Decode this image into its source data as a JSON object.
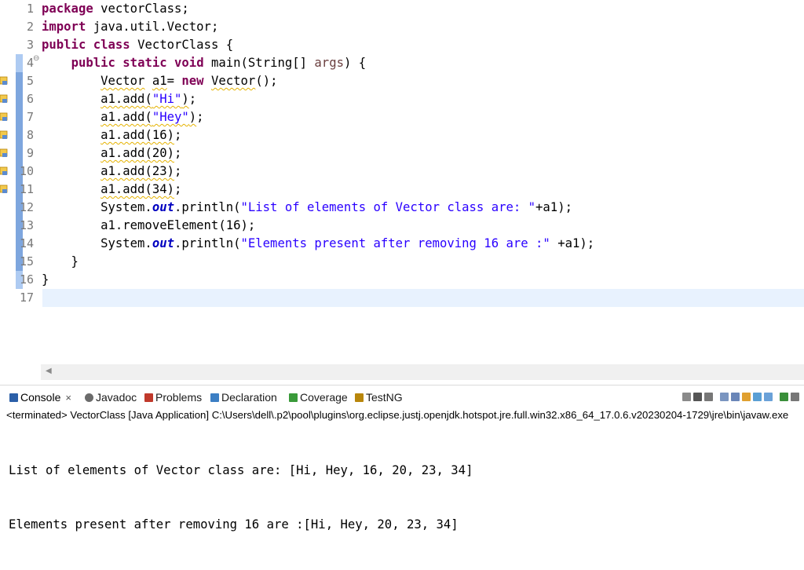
{
  "editor": {
    "lines": [
      {
        "num": "1",
        "segs": [
          {
            "t": "package",
            "c": "kw"
          },
          {
            "t": " vectorClass;"
          }
        ]
      },
      {
        "num": "2",
        "segs": [
          {
            "t": "import",
            "c": "kw"
          },
          {
            "t": " java.util.Vector;"
          }
        ]
      },
      {
        "num": "3",
        "segs": [
          {
            "t": "public",
            "c": "kw"
          },
          {
            "t": " "
          },
          {
            "t": "class",
            "c": "kw"
          },
          {
            "t": " VectorClass {"
          }
        ]
      },
      {
        "num": "4",
        "fold": "⊖",
        "segs": [
          {
            "t": "    "
          },
          {
            "t": "public",
            "c": "kw"
          },
          {
            "t": " "
          },
          {
            "t": "static",
            "c": "kw"
          },
          {
            "t": " "
          },
          {
            "t": "void",
            "c": "kw"
          },
          {
            "t": " main(String[] "
          },
          {
            "t": "args",
            "c": "arg"
          },
          {
            "t": ") {"
          }
        ]
      },
      {
        "num": "5",
        "marker": true,
        "segs": [
          {
            "t": "        "
          },
          {
            "t": "Vector",
            "c": "warn"
          },
          {
            "t": " "
          },
          {
            "t": "a1",
            "c": "warn"
          },
          {
            "t": "= "
          },
          {
            "t": "new",
            "c": "kw"
          },
          {
            "t": " "
          },
          {
            "t": "Vector",
            "c": "warn"
          },
          {
            "t": "();"
          }
        ]
      },
      {
        "num": "6",
        "marker": true,
        "segs": [
          {
            "t": "        "
          },
          {
            "t": "a1.add(",
            "c": "warn"
          },
          {
            "t": "\"Hi\"",
            "c": "str warn"
          },
          {
            "t": ")",
            "c": "warn"
          },
          {
            "t": ";"
          }
        ]
      },
      {
        "num": "7",
        "marker": true,
        "segs": [
          {
            "t": "        "
          },
          {
            "t": "a1.add(",
            "c": "warn"
          },
          {
            "t": "\"Hey\"",
            "c": "str warn"
          },
          {
            "t": ")",
            "c": "warn"
          },
          {
            "t": ";"
          }
        ]
      },
      {
        "num": "8",
        "marker": true,
        "segs": [
          {
            "t": "        "
          },
          {
            "t": "a1.add(16)",
            "c": "warn"
          },
          {
            "t": ";"
          }
        ]
      },
      {
        "num": "9",
        "marker": true,
        "segs": [
          {
            "t": "        "
          },
          {
            "t": "a1.add(20)",
            "c": "warn"
          },
          {
            "t": ";"
          }
        ]
      },
      {
        "num": "10",
        "marker": true,
        "segs": [
          {
            "t": "        "
          },
          {
            "t": "a1.add(23)",
            "c": "warn"
          },
          {
            "t": ";"
          }
        ]
      },
      {
        "num": "11",
        "marker": true,
        "segs": [
          {
            "t": "        "
          },
          {
            "t": "a1.add(34)",
            "c": "warn"
          },
          {
            "t": ";"
          }
        ]
      },
      {
        "num": "12",
        "segs": [
          {
            "t": "        System."
          },
          {
            "t": "out",
            "c": "fld"
          },
          {
            "t": ".println("
          },
          {
            "t": "\"List of elements of Vector class are: \"",
            "c": "str"
          },
          {
            "t": "+a1);"
          }
        ]
      },
      {
        "num": "13",
        "segs": [
          {
            "t": "        a1.removeElement(16);"
          }
        ]
      },
      {
        "num": "14",
        "segs": [
          {
            "t": "        System."
          },
          {
            "t": "out",
            "c": "fld"
          },
          {
            "t": ".println("
          },
          {
            "t": "\"Elements present after removing 16 are :\"",
            "c": "str"
          },
          {
            "t": " +a1);"
          }
        ]
      },
      {
        "num": "15",
        "segs": [
          {
            "t": "    }"
          }
        ]
      },
      {
        "num": "16",
        "segs": [
          {
            "t": "}"
          }
        ]
      },
      {
        "num": "17",
        "current": true,
        "segs": []
      }
    ],
    "hscroll_arrow": "◀"
  },
  "console": {
    "tabs": [
      {
        "name": "console",
        "label": "Console",
        "icon": "console-icon",
        "close": "×",
        "color": "#2b5fa8"
      },
      {
        "name": "javadoc",
        "label": "Javadoc",
        "icon": "at-sign-icon",
        "color": "#6b6b6b"
      },
      {
        "name": "problems",
        "label": "Problems",
        "icon": "problems-icon",
        "color": "#c0392b"
      },
      {
        "name": "declaration",
        "label": "Declaration",
        "icon": "declaration-icon",
        "color": "#3c7fc4"
      },
      {
        "name": "coverage",
        "label": "Coverage",
        "icon": "coverage-icon",
        "color": "#3a9a3a"
      },
      {
        "name": "testng",
        "label": "TestNG",
        "icon": "testng-icon",
        "color": "#b8860b"
      }
    ],
    "tools": [
      {
        "name": "terminate-icon",
        "color": "#8a8a8a"
      },
      {
        "name": "remove-launch-icon",
        "color": "#555555"
      },
      {
        "name": "remove-all-icon",
        "color": "#777777"
      },
      {
        "name": "clear-console-icon",
        "color": "#7a95c0"
      },
      {
        "name": "scroll-lock-icon",
        "color": "#6a86b8"
      },
      {
        "name": "word-wrap-icon",
        "color": "#e0a030"
      },
      {
        "name": "pin-console-icon",
        "color": "#5a9fd4"
      },
      {
        "name": "display-console-icon",
        "color": "#6aa1d8"
      },
      {
        "name": "open-console-icon",
        "color": "#3a8f3a"
      },
      {
        "name": "minimize-icon",
        "color": "#777777"
      }
    ],
    "status": "<terminated> VectorClass [Java Application] C:\\Users\\dell\\.p2\\pool\\plugins\\org.eclipse.justj.openjdk.hotspot.jre.full.win32.x86_64_17.0.6.v20230204-1729\\jre\\bin\\javaw.exe",
    "output": [
      "List of elements of Vector class are: [Hi, Hey, 16, 20, 23, 34]",
      "Elements present after removing 16 are :[Hi, Hey, 20, 23, 34]"
    ]
  }
}
